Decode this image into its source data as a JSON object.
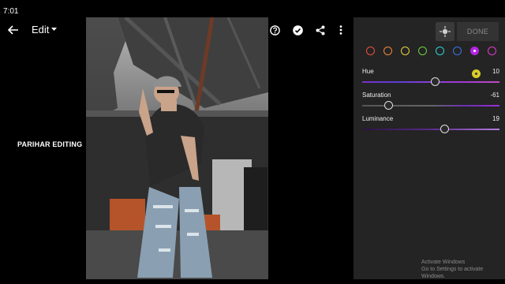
{
  "status": {
    "time": "7:01"
  },
  "toolbar": {
    "edit_label": "Edit",
    "back_icon": "arrow-left-icon",
    "caret_icon": "caret-down-icon",
    "undo_icon": "undo-icon",
    "help_icon": "help-icon",
    "check_icon": "check-icon",
    "share_icon": "share-icon",
    "more_icon": "more-vertical-icon"
  },
  "watermark": "PARIHAR EDITING",
  "panel": {
    "done_label": "DONE",
    "target_icon": "target-adjust-icon",
    "swatches": [
      {
        "name": "red",
        "color": "#ef4f3c"
      },
      {
        "name": "orange",
        "color": "#f2893a"
      },
      {
        "name": "yellow",
        "color": "#e8d33c"
      },
      {
        "name": "green",
        "color": "#6fcf3f"
      },
      {
        "name": "aqua",
        "color": "#2fd2d8"
      },
      {
        "name": "blue",
        "color": "#3a72e8"
      },
      {
        "name": "purple",
        "color": "#b226e0",
        "selected": true
      },
      {
        "name": "magenta",
        "color": "#e03ccf"
      }
    ],
    "sliders": [
      {
        "label": "Hue",
        "value": "10",
        "fraction": 0.53
      },
      {
        "label": "Saturation",
        "value": "-61",
        "fraction": 0.19
      },
      {
        "label": "Luminance",
        "value": "19",
        "fraction": 0.6
      }
    ]
  },
  "activate": {
    "line1": "Activate Windows",
    "line2": "Go to Settings to activate Windows."
  }
}
